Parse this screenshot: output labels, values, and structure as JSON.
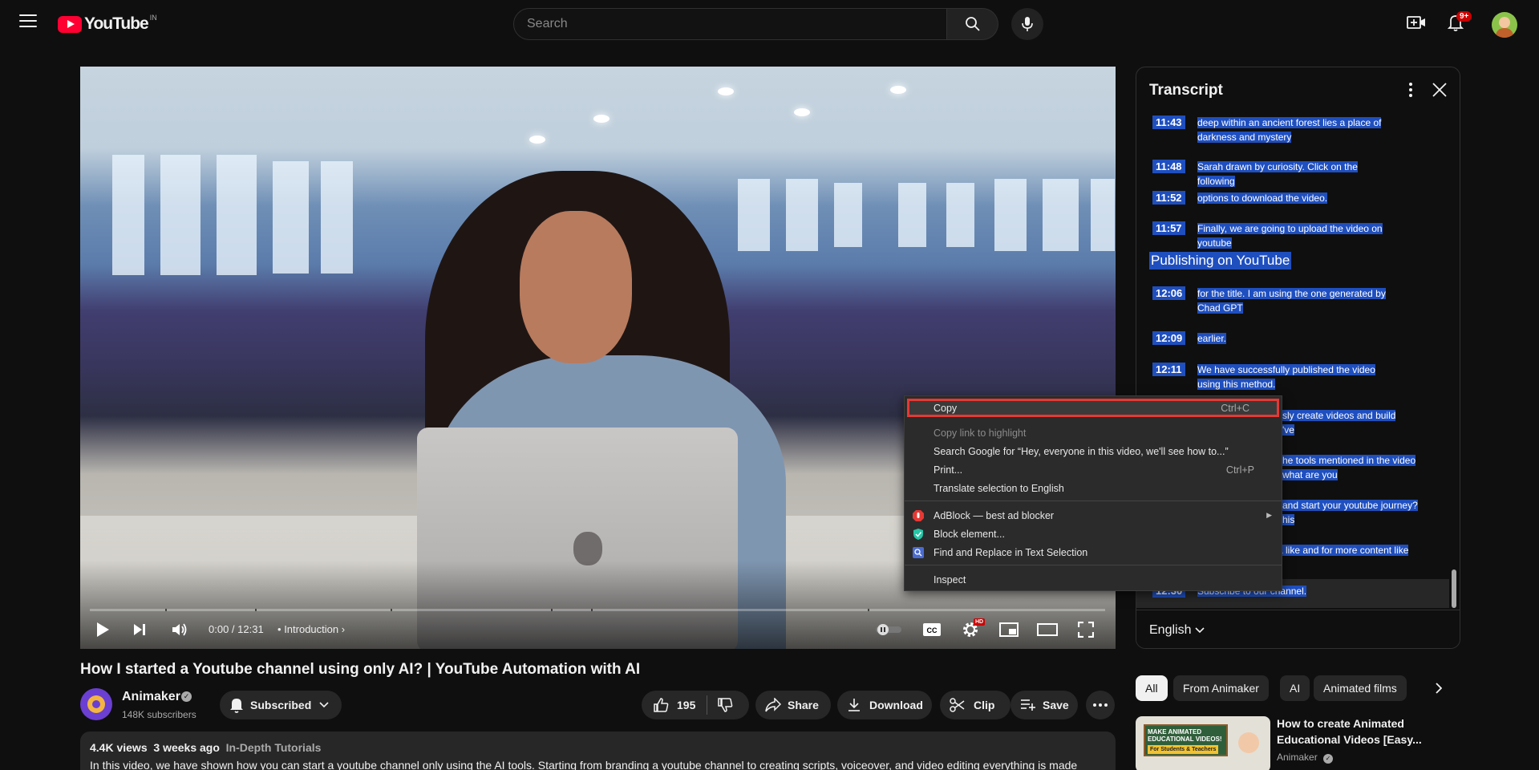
{
  "header": {
    "logo_text": "YouTube",
    "country_code": "IN",
    "search_placeholder": "Search",
    "notification_count": "9+"
  },
  "player": {
    "time": "0:00 / 12:31",
    "chapter_separator": "•",
    "chapter": "Introduction",
    "hd_label": "HD"
  },
  "context_menu": {
    "items": [
      {
        "label": "Copy",
        "shortcut": "Ctrl+C"
      },
      {
        "label": "Copy link to highlight",
        "shortcut": ""
      },
      {
        "label": "Search Google for “Hey, everyone in this video, we'll  see how to...”",
        "shortcut": ""
      },
      {
        "label": "Print...",
        "shortcut": "Ctrl+P"
      },
      {
        "label": "Translate selection to English",
        "shortcut": ""
      },
      {
        "label": "AdBlock — best ad blocker",
        "shortcut": ""
      },
      {
        "label": "Block element...",
        "shortcut": ""
      },
      {
        "label": "Find and Replace in Text Selection",
        "shortcut": ""
      },
      {
        "label": "Inspect",
        "shortcut": ""
      }
    ]
  },
  "transcript": {
    "title": "Transcript",
    "chapter_heading": "Publishing on YouTube",
    "language": "English",
    "segments": [
      {
        "time": "11:43",
        "text": "deep within an ancient forest lies  a place of darkness and mystery"
      },
      {
        "time": "11:48",
        "text": "Sarah drawn by curiosity. Click on the following"
      },
      {
        "time": "11:52",
        "text": "options to download the video."
      },
      {
        "time": "11:57",
        "text": "Finally, we are going to  upload the video on youtube"
      },
      {
        "time": "12:06",
        "text": "for the title. I am using  the one generated by Chad GPT"
      },
      {
        "time": "12:09",
        "text": "earlier."
      },
      {
        "time": "12:11",
        "text": "We have successfully published  the video using this method."
      },
      {
        "time": "",
        "text": "sly create videos  and build a"
      },
      {
        "time": "",
        "text": "'ve"
      },
      {
        "time": "",
        "text": "he tools mentioned in  the video in"
      },
      {
        "time": "",
        "text": "what are you"
      },
      {
        "time": "",
        "text": "and start your  youtube journey?"
      },
      {
        "time": "",
        "text": "his"
      },
      {
        "time": "",
        "text": "a like and  for more content like"
      },
      {
        "time": "12:30",
        "text": "Subscribe to our channel."
      }
    ]
  },
  "video_info": {
    "title": "How I started a Youtube channel using only AI? | YouTube Automation with AI",
    "channel": "Animaker",
    "subscribers": "148K subscribers",
    "subscribed_label": "Subscribed",
    "likes": "195",
    "share": "Share",
    "download": "Download",
    "clip": "Clip",
    "save": "Save",
    "views": "4.4K views",
    "age": "3 weeks ago",
    "tag": "In-Depth Tutorials",
    "description": "In this video, we have shown how you can start a youtube channel only using the AI tools. Starting from branding a youtube channel to creating scripts, voiceover, and video editing everything is made"
  },
  "chips": [
    "All",
    "From Animaker",
    "AI",
    "Animated films"
  ],
  "recommendation": {
    "thumb_line1": "MAKE ANIMATED",
    "thumb_line2": "EDUCATIONAL VIDEOS!",
    "thumb_sub": "For Students & Teachers",
    "title": "How to create Animated Educational Videos [Easy...",
    "channel": "Animaker"
  },
  "colors": {
    "selection_blue": "#1f4fbf",
    "highlight_red": "#e53935",
    "brand_red": "#ff0033"
  }
}
